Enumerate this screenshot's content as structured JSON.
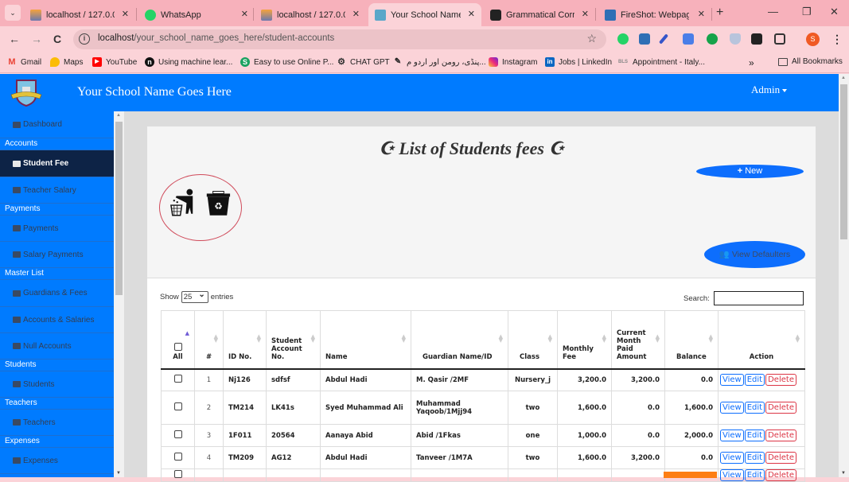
{
  "browser": {
    "tabs": [
      {
        "title": "localhost / 127.0.0.1 / ...",
        "favicon": "phpmyadmin-icon",
        "active": false
      },
      {
        "title": "WhatsApp",
        "favicon": "whatsapp-icon",
        "active": false
      },
      {
        "title": "localhost / 127.0.0.1 / ...",
        "favicon": "phpmyadmin-icon",
        "active": false
      },
      {
        "title": "Your School Name Goes Here",
        "favicon": "school-icon",
        "active": true
      },
      {
        "title": "Grammatical Correction",
        "favicon": "chatgpt-icon",
        "active": false
      },
      {
        "title": "FireShot: Webpage Screenshot",
        "favicon": "fireshot-icon",
        "active": false
      }
    ],
    "url_host": "localhost",
    "url_path": "/your_school_name_goes_here/student-accounts",
    "profile_initial": "S",
    "bookmarks": [
      {
        "label": "Gmail",
        "icon": "gmail-icon"
      },
      {
        "label": "Maps",
        "icon": "maps-icon"
      },
      {
        "label": "YouTube",
        "icon": "youtube-icon"
      },
      {
        "label": "Using machine lear...",
        "icon": "medium-icon"
      },
      {
        "label": "Easy to use Online P...",
        "icon": "s-icon"
      },
      {
        "label": "CHAT GPT",
        "icon": "chatgpt-icon"
      },
      {
        "label": "پنڈی، رومن اور اردو م...",
        "icon": "urdu-icon"
      },
      {
        "label": "Instagram",
        "icon": "instagram-icon"
      },
      {
        "label": "Jobs | LinkedIn",
        "icon": "linkedin-icon"
      },
      {
        "label": "Appointment - Italy...",
        "icon": "bls-icon"
      }
    ],
    "more_bookmarks": "»",
    "all_bookmarks": "All Bookmarks"
  },
  "header": {
    "site_title": "Your School Name Goes Here",
    "user_menu": "Admin"
  },
  "sidebar": {
    "items": [
      {
        "type": "link",
        "label": "Dashboard",
        "icon": "chart-icon"
      },
      {
        "type": "heading",
        "label": "Accounts"
      },
      {
        "type": "link",
        "label": "Student Fee",
        "icon": "card-icon",
        "active": true
      },
      {
        "type": "link",
        "label": "Teacher Salary",
        "icon": "card-icon"
      },
      {
        "type": "heading",
        "label": "Payments"
      },
      {
        "type": "link",
        "label": "Payments",
        "icon": "table-icon"
      },
      {
        "type": "link",
        "label": "Salary Payments",
        "icon": "table-icon"
      },
      {
        "type": "heading",
        "label": "Master List"
      },
      {
        "type": "link",
        "label": "Guardians & Fees",
        "icon": "scroll-icon"
      },
      {
        "type": "link",
        "label": "Accounts & Salaries",
        "icon": "scroll-icon"
      },
      {
        "type": "link",
        "label": "Null Accounts",
        "icon": "scroll-icon"
      },
      {
        "type": "heading",
        "label": "Students"
      },
      {
        "type": "link",
        "label": "Students",
        "icon": "users-icon"
      },
      {
        "type": "heading",
        "label": "Teachers"
      },
      {
        "type": "link",
        "label": "Teachers",
        "icon": "chalkboard-icon"
      },
      {
        "type": "heading",
        "label": "Expenses"
      },
      {
        "type": "link",
        "label": "Expenses",
        "icon": "calculator-icon"
      }
    ]
  },
  "main": {
    "title": "List of Students fees",
    "title_icon": "☪",
    "new_button": "New",
    "defaulters_button": "View Defaulters",
    "show_label": "Show",
    "entries_value": "25",
    "entries_label": "entries",
    "search_label": "Search:",
    "search_value": "",
    "table": {
      "columns": [
        {
          "label": "All",
          "sort": "asc"
        },
        {
          "label": "#",
          "sort": "both"
        },
        {
          "label": "ID No.",
          "sort": "both"
        },
        {
          "label": "Student Account No.",
          "sort": "both"
        },
        {
          "label": "Name",
          "sort": "both"
        },
        {
          "label": "Guardian Name/ID",
          "sort": "both"
        },
        {
          "label": "Class",
          "sort": "both"
        },
        {
          "label": "Monthly Fee",
          "sort": "both"
        },
        {
          "label": "Current Month Paid Amount",
          "sort": "both"
        },
        {
          "label": "Balance",
          "sort": "both"
        },
        {
          "label": "Action",
          "sort": "both"
        }
      ],
      "rows": [
        {
          "n": "1",
          "id": "Nj126",
          "acct": "sdfsf",
          "name": "Abdul Hadi",
          "guardian": "M. Qasir /2MF",
          "class": "Nursery_j",
          "fee": "3,200.0",
          "paid": "3,200.0",
          "balance": "0.0"
        },
        {
          "n": "2",
          "id": "TM214",
          "acct": "LK41s",
          "name": "Syed Muhammad Ali",
          "guardian": "Muhammad Yaqoob/1Mjj94",
          "class": "two",
          "fee": "1,600.0",
          "paid": "0.0",
          "balance": "1,600.0"
        },
        {
          "n": "3",
          "id": "1F011",
          "acct": "20564",
          "name": "Aanaya Abid",
          "guardian": "Abid /1Fkas",
          "class": "one",
          "fee": "1,000.0",
          "paid": "0.0",
          "balance": "2,000.0"
        },
        {
          "n": "4",
          "id": "TM209",
          "acct": "AG12",
          "name": "Abdul Hadi",
          "guardian": "Tanveer /1M7A",
          "class": "two",
          "fee": "1,600.0",
          "paid": "3,200.0",
          "balance": "0.0"
        }
      ],
      "actions": {
        "view": "View",
        "edit": "Edit",
        "delete": "Delete"
      }
    }
  }
}
